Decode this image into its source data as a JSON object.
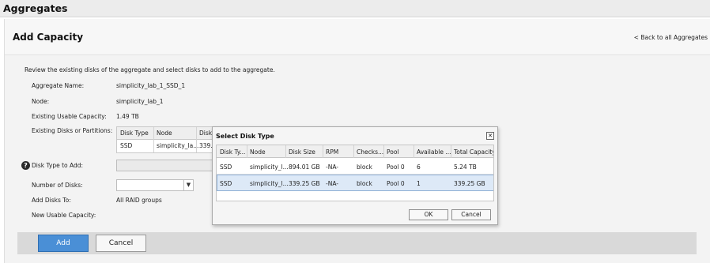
{
  "app": {
    "section_title": "Aggregates"
  },
  "panel": {
    "title": "Add Capacity",
    "back_link": "< Back to all Aggregates"
  },
  "form": {
    "intro": "Review the existing disks of the aggregate and select disks to add to the aggregate.",
    "aggregate_name_label": "Aggregate Name:",
    "aggregate_name_value": "simplicity_lab_1_SSD_1",
    "node_label": "Node:",
    "node_value": "simplicity_lab_1",
    "usable_label": "Existing Usable Capacity:",
    "usable_value": "1.49 TB",
    "existing_disks_label": "Existing Disks or Partitions:",
    "existing_table": {
      "headers": [
        "Disk Type",
        "Node",
        "Disk S"
      ],
      "row": [
        "SSD",
        "simplicity_la...",
        "339.25"
      ]
    },
    "disk_type_label": "Disk Type to Add:",
    "num_disks_label": "Number of Disks:",
    "add_disks_to_label": "Add Disks To:",
    "add_disks_to_value": "All RAID groups",
    "new_usable_label": "New Usable Capacity:"
  },
  "footer": {
    "add_label": "Add",
    "cancel_label": "Cancel"
  },
  "dialog": {
    "title": "Select Disk Type",
    "headers": [
      "Disk Ty...",
      "Node",
      "Disk Size",
      "RPM",
      "Checks...",
      "Pool",
      "Available ...",
      "Total Capacity"
    ],
    "rows": [
      [
        "SSD",
        "simplicity_l...",
        "894.01 GB",
        "-NA-",
        "block",
        "Pool 0",
        "6",
        "5.24 TB"
      ],
      [
        "SSD",
        "simplicity_l...",
        "339.25 GB",
        "-NA-",
        "block",
        "Pool 0",
        "1",
        "339.25 GB"
      ]
    ],
    "ok_label": "OK",
    "cancel_label": "Cancel"
  },
  "icons": {
    "help": "question-circle-icon",
    "close": "close-icon",
    "dropdown": "chevron-down-icon"
  },
  "colors": {
    "primary_button": "#4a8fd6",
    "selected_row": "#dde9f7"
  }
}
